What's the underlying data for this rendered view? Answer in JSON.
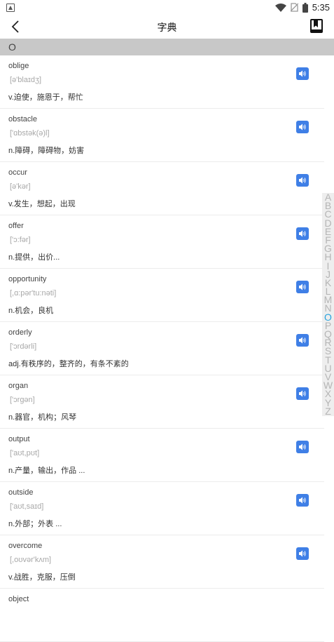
{
  "status_bar": {
    "time": "5:35",
    "icons": [
      "app-notification-icon",
      "wifi-icon",
      "no-sim-icon",
      "battery-icon"
    ]
  },
  "header": {
    "title": "字典"
  },
  "section": {
    "letter": "O"
  },
  "entries": [
    {
      "word": "oblige",
      "phonetic": "[ə'blaɪdʒ]",
      "meaning": "v.迫使，施恩于，帮忙"
    },
    {
      "word": "obstacle",
      "phonetic": "['ɑbstək(ə)l]",
      "meaning": "n.障碍，障碍物，妨害"
    },
    {
      "word": "occur",
      "phonetic": "[ə'kər]",
      "meaning": "v.发生，想起，出现"
    },
    {
      "word": "offer",
      "phonetic": "['ɔ:fər]",
      "meaning": "n.提供，出价..."
    },
    {
      "word": "opportunity",
      "phonetic": "[,ɑ:pər'tu:nəti]",
      "meaning": "n.机会，良机"
    },
    {
      "word": "orderly",
      "phonetic": "['ɔrdərli]",
      "meaning": "adj.有秩序的，整齐的，有条不紊的"
    },
    {
      "word": "organ",
      "phonetic": "['ɔrgən]",
      "meaning": "n.器官，机构；风琴"
    },
    {
      "word": "output",
      "phonetic": "['aʊt,pʊt]",
      "meaning": "n.产量，输出，作品 ..."
    },
    {
      "word": "outside",
      "phonetic": "['aʊt,saɪd]",
      "meaning": "n.外部；外表 ..."
    },
    {
      "word": "overcome",
      "phonetic": "[,oʊvər'kʌm]",
      "meaning": "v.战胜，克服，压倒"
    },
    {
      "word": "object",
      "phonetic": "",
      "meaning": ""
    }
  ],
  "alphabet_index": {
    "letters": [
      "A",
      "B",
      "C",
      "D",
      "E",
      "F",
      "G",
      "H",
      "I",
      "J",
      "K",
      "L",
      "M",
      "N",
      "O",
      "P",
      "Q",
      "R",
      "S",
      "T",
      "U",
      "V",
      "W",
      "X",
      "Y",
      "Z"
    ],
    "active": "O"
  },
  "colors": {
    "accent_blue": "#3f7fe6",
    "index_active": "#29a3de",
    "section_header_bg": "#c8c8c8"
  }
}
